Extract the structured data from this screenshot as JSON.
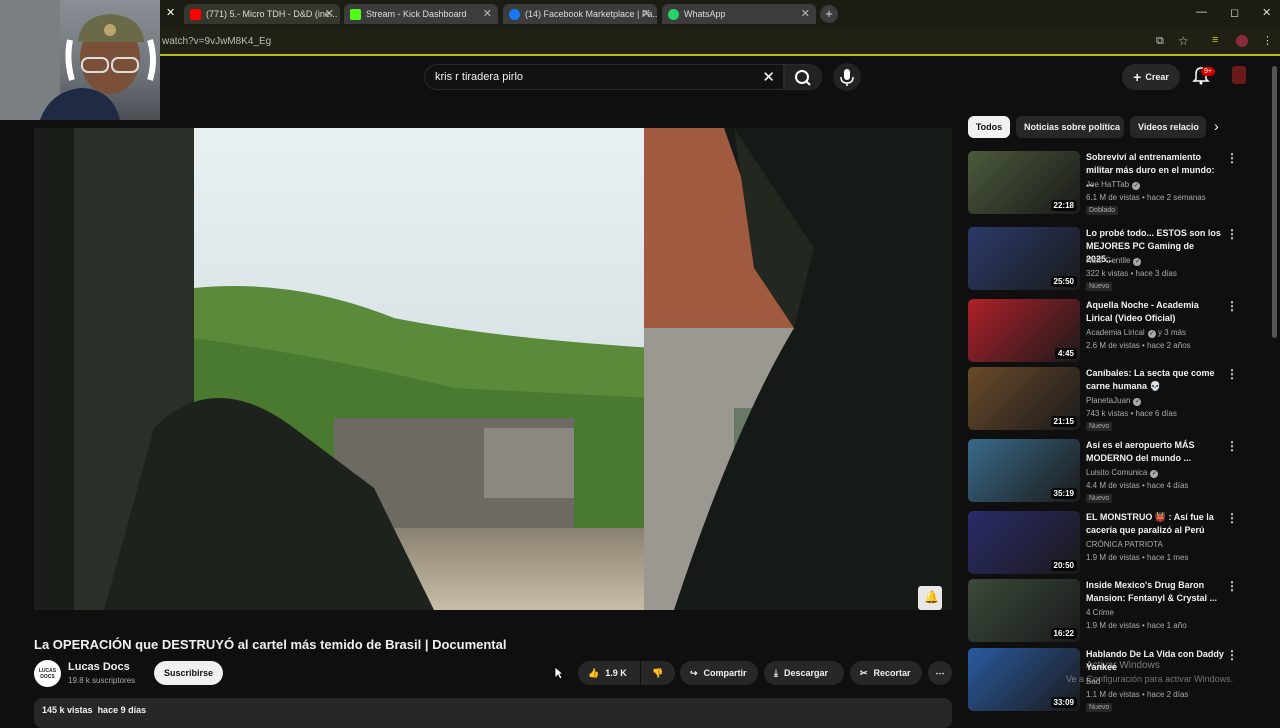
{
  "browser": {
    "tabs": [
      {
        "title": "(771) 5.- Micro TDH - D&D (ine...",
        "favicon": "youtube-icon",
        "color": "#ff0000"
      },
      {
        "title": "Stream - Kick Dashboard",
        "favicon": "kick-icon",
        "color": "#53fc18"
      },
      {
        "title": "(14) Facebook Marketplace | Fa...",
        "favicon": "facebook-icon",
        "color": "#1877f2"
      },
      {
        "title": "WhatsApp",
        "favicon": "whatsapp-icon",
        "color": "#25d366"
      }
    ],
    "url": "watch?v=9vJwM8K4_Eg"
  },
  "header": {
    "search_query": "kris r tiradera pirlo",
    "create_label": "Crear",
    "notification_count": "9+"
  },
  "video": {
    "title": "La OPERACIÓN que DESTRUYÓ al cartel más temido de Brasil | Documental",
    "channel": "Lucas Docs",
    "channel_avatar_text": "LUCAS DOCS",
    "subscribers": "19.8 k suscriptores",
    "subscribe_label": "Suscribirse",
    "likes": "1.9 K",
    "share_label": "Compartir",
    "download_label": "Descargar",
    "clip_label": "Recortar",
    "views": "145 k vistas",
    "date": "hace 9 días"
  },
  "chips": [
    "Todos",
    "Noticias sobre política",
    "Videos relacio"
  ],
  "recommendations": [
    {
      "title": "Sobreviví al entrenamiento militar más duro en el mundo: ...",
      "channel": "Joe HaTTab",
      "verified": true,
      "meta": "6.1 M de vistas • hace 2 semanas",
      "badge": "Doblado",
      "duration": "22:18",
      "thumb_color": "#4a5a3a"
    },
    {
      "title": "Lo probé todo... ESTOS son los MEJORES PC Gaming de 2025...",
      "channel": "Nate Gentile",
      "verified": true,
      "meta": "322 k vistas • hace 3 días",
      "badge": "Nuevo",
      "duration": "25:50",
      "thumb_color": "#2a3a6a"
    },
    {
      "title": "Aquella Noche - Academia Lirical (Video Oficial)",
      "channel": "Academia Lirical",
      "verified": true,
      "channel_extra": "y 3 más",
      "meta": "2.6 M de vistas • hace 2 años",
      "badge": "",
      "duration": "4:45",
      "thumb_color": "#b0202a"
    },
    {
      "title": "Caníbales: La secta que come carne humana 💀",
      "channel": "PlanetaJuan",
      "verified": true,
      "meta": "743 k vistas • hace 6 días",
      "badge": "Nuevo",
      "duration": "21:15",
      "thumb_color": "#6a4a2a"
    },
    {
      "title": "Así es el aeropuerto MÁS MODERNO del mundo ...",
      "channel": "Luisito Comunica",
      "verified": true,
      "meta": "4.4 M de vistas • hace 4 días",
      "badge": "Nuevo",
      "duration": "35:19",
      "thumb_color": "#3a6a8a"
    },
    {
      "title": "EL MONSTRUO 👹 : Así fue la cacería que paralizó al Perú",
      "channel": "CRÓNICA PATRIOTA",
      "verified": false,
      "meta": "1.9 M de vistas • hace 1 mes",
      "badge": "",
      "duration": "20:50",
      "thumb_color": "#2a2a6a"
    },
    {
      "title": "Inside Mexico's Drug Baron Mansion: Fentanyl & Crystal ...",
      "channel": "4 Crime",
      "verified": false,
      "meta": "1.9 M de vistas • hace 1 año",
      "badge": "",
      "duration": "16:22",
      "thumb_color": "#3a4a3a"
    },
    {
      "title": "Hablando De La Vida con Daddy Yankee",
      "channel": "Bad",
      "verified": false,
      "meta": "1.1 M de vistas • hace 2 días",
      "badge": "Nuevo",
      "duration": "33:09",
      "thumb_color": "#2a5aa0"
    }
  ],
  "watermark": {
    "line1": "Activar Windows",
    "line2": "Ve a Configuración para activar Windows."
  }
}
